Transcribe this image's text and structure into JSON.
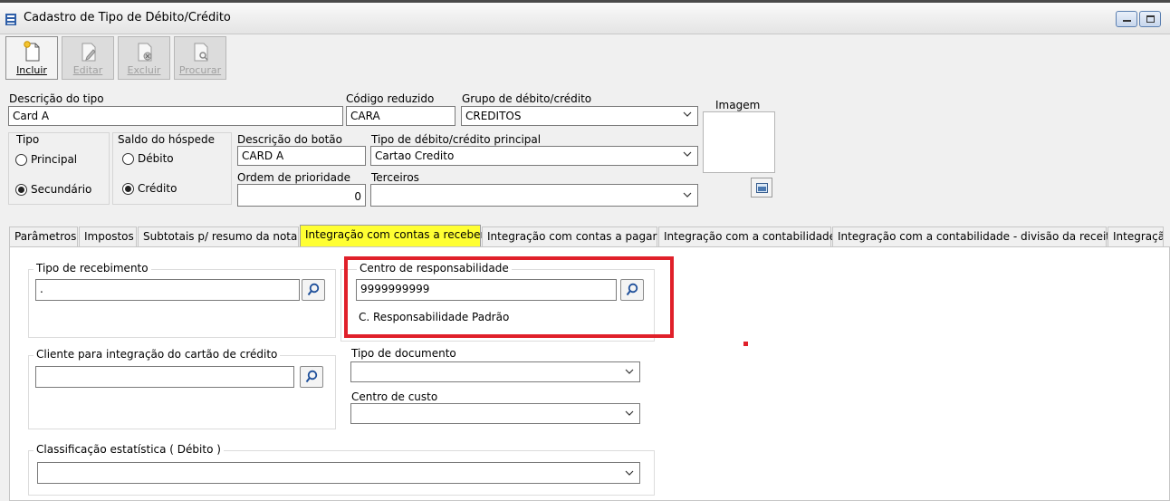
{
  "window": {
    "title": "Cadastro de Tipo de Débito/Crédito"
  },
  "toolbar": {
    "items": [
      {
        "label": "Incluir",
        "enabled": true
      },
      {
        "label": "Editar",
        "enabled": false
      },
      {
        "label": "Excluir",
        "enabled": false
      },
      {
        "label": "Procurar",
        "enabled": false
      }
    ]
  },
  "form": {
    "descricao_tipo_label": "Descrição do tipo",
    "descricao_tipo_value": "Card A",
    "codigo_reduzido_label": "Código reduzido",
    "codigo_reduzido_value": "CARA",
    "grupo_label": "Grupo de débito/crédito",
    "grupo_value": "CREDITOS",
    "imagem_label": "Imagem",
    "tipo_label": "Tipo",
    "tipo_options": [
      "Principal",
      "Secundário"
    ],
    "tipo_selected": "Secundário",
    "saldo_label": "Saldo do hóspede",
    "saldo_options": [
      "Débito",
      "Crédito"
    ],
    "saldo_selected": "Crédito",
    "descricao_botao_label": "Descrição do botão",
    "descricao_botao_value": "CARD A",
    "tipo_principal_label": "Tipo de débito/crédito principal",
    "tipo_principal_value": "Cartao Credito",
    "ordem_label": "Ordem de prioridade",
    "ordem_value": "0",
    "terceiros_label": "Terceiros",
    "terceiros_value": ""
  },
  "tabs": [
    {
      "label": "Parâmetros",
      "selected": false
    },
    {
      "label": "Impostos",
      "selected": false
    },
    {
      "label": "Subtotais p/ resumo da nota",
      "selected": false
    },
    {
      "label": "Integração com contas a receber",
      "selected": true
    },
    {
      "label": "Integração com contas a pagar",
      "selected": false
    },
    {
      "label": "Integração com a contabilidade",
      "selected": false
    },
    {
      "label": "Integração com a contabilidade - divisão da receita",
      "selected": false
    },
    {
      "label": "Integraçã",
      "selected": false
    }
  ],
  "panel": {
    "tipo_recebimento_label": "Tipo de recebimento",
    "tipo_recebimento_value": ".",
    "centro_resp_label": "Centro de responsabilidade",
    "centro_resp_value": "9999999999",
    "centro_resp_desc": "C. Responsabilidade Padrão",
    "cliente_label": "Cliente para integração do cartão de crédito",
    "cliente_value": "",
    "tipo_documento_label": "Tipo de documento",
    "tipo_documento_value": "",
    "centro_custo_label": "Centro de custo",
    "centro_custo_value": "",
    "classificacao_label": "Classificação estatística ( Débito )",
    "classificacao_value": ""
  },
  "colors": {
    "highlight_tab": "#ffff33",
    "annotation_red": "#e0202a"
  }
}
